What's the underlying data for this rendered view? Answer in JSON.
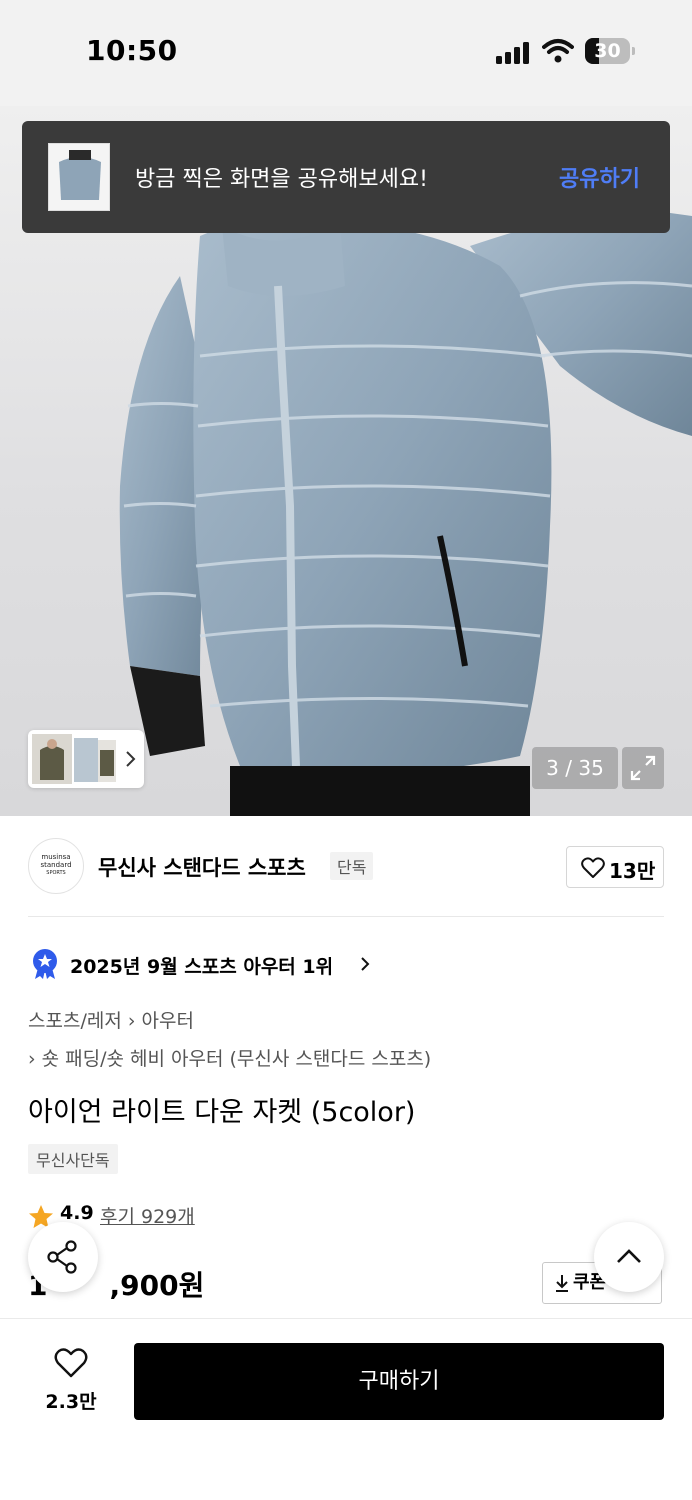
{
  "status_bar": {
    "time": "10:50",
    "battery": "30"
  },
  "toast": {
    "message": "방금 찍은 화면을 공유해보세요!",
    "action_label": "공유하기"
  },
  "gallery": {
    "counter": "3 / 35"
  },
  "brand": {
    "logo_lines": [
      "musinsa",
      "standard",
      "SPORTS"
    ],
    "name": "무신사 스탠다드 스포츠",
    "badge": "단독",
    "like_count": "13만"
  },
  "ranking": {
    "text": "2025년 9월 스포츠 아우터 1위"
  },
  "breadcrumb": {
    "line1": "스포츠/레저  › 아우터",
    "line2": "› 숏 패딩/숏 헤비 아우터 (무신사 스탠다드 스포츠)"
  },
  "product": {
    "title": "아이언 라이트 다운 자켓 (5color)",
    "exclusive_badge": "무신사단독",
    "rating": "4.9",
    "review_label": "후기 929개",
    "price": "1",
    "price_rest": ",900원",
    "coupon_label": "쿠폰"
  },
  "bottom_bar": {
    "wishlist_count": "2.3만",
    "buy_label": "구매하기"
  },
  "colors": {
    "accent_link": "#4f7df6",
    "toast_bg": "#3a3a3a",
    "jacket": "#8fa5b8",
    "star": "#f5a623",
    "badge_blue": "#2f5bea"
  }
}
